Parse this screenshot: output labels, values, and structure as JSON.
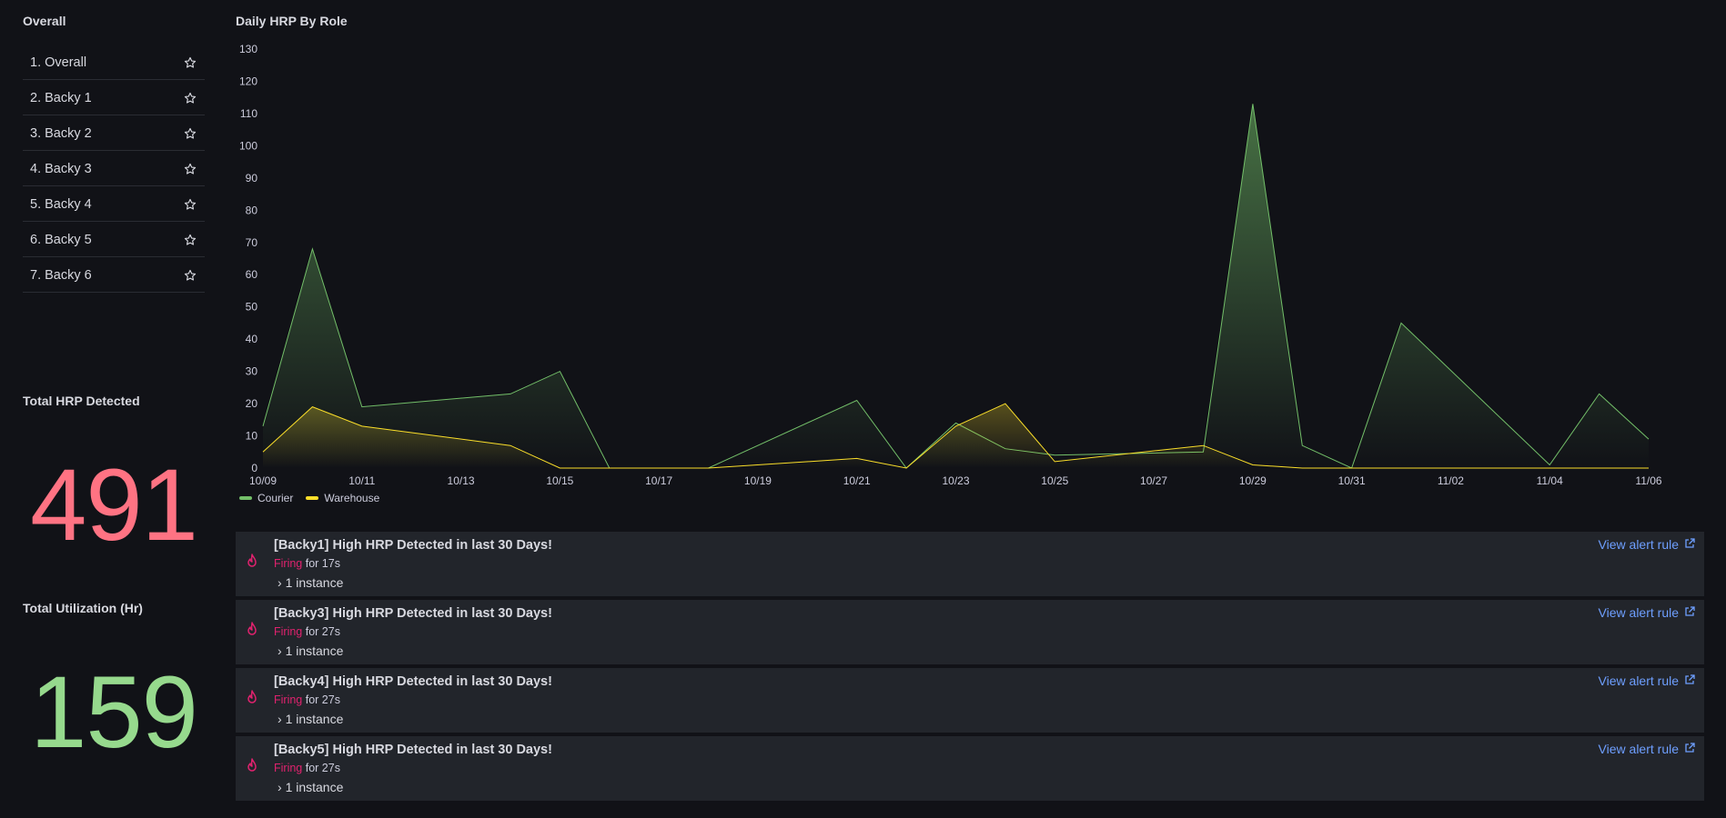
{
  "dashboard_list": {
    "title": "Overall",
    "items": [
      {
        "label": "1. Overall"
      },
      {
        "label": "2. Backy 1"
      },
      {
        "label": "3. Backy 2"
      },
      {
        "label": "4. Backy 3"
      },
      {
        "label": "5. Backy 4"
      },
      {
        "label": "6. Backy 5"
      },
      {
        "label": "7. Backy 6"
      }
    ],
    "item_icon": "star-icon"
  },
  "stats": {
    "total_hrp": {
      "title": "Total HRP Detected",
      "value": "491",
      "color": "#ff7383"
    },
    "total_util": {
      "title": "Total Utilization (Hr)",
      "value": "159",
      "color": "#96d98d"
    }
  },
  "chart_panel": {
    "title": "Daily HRP By Role"
  },
  "chart_data": {
    "type": "area",
    "title": "Daily HRP By Role",
    "x": [
      "10/09",
      "10/10",
      "10/11",
      "10/12",
      "10/13",
      "10/14",
      "10/15",
      "10/16",
      "10/17",
      "10/18",
      "10/19",
      "10/20",
      "10/21",
      "10/22",
      "10/23",
      "10/24",
      "10/25",
      "10/26",
      "10/27",
      "10/28",
      "10/29",
      "10/30",
      "10/31",
      "11/01",
      "11/02",
      "11/03",
      "11/04",
      "11/05",
      "11/06"
    ],
    "x_tick_labels": [
      "10/09",
      "10/11",
      "10/13",
      "10/15",
      "10/17",
      "10/19",
      "10/21",
      "10/23",
      "10/25",
      "10/27",
      "10/29",
      "10/31",
      "11/02",
      "11/04",
      "11/06"
    ],
    "ylim": [
      0,
      130
    ],
    "y_ticks": [
      0,
      10,
      20,
      30,
      40,
      50,
      60,
      70,
      80,
      90,
      100,
      110,
      120,
      130
    ],
    "series": [
      {
        "name": "Courier",
        "color": "#73bf69",
        "values": [
          13,
          68,
          19,
          null,
          null,
          23,
          30,
          0,
          0,
          0,
          null,
          null,
          21,
          0,
          14,
          6,
          4,
          null,
          null,
          5,
          113,
          7,
          0,
          45,
          null,
          null,
          1,
          23,
          9
        ]
      },
      {
        "name": "Warehouse",
        "color": "#fade2a",
        "values": [
          5,
          19,
          13,
          null,
          null,
          7,
          0,
          0,
          0,
          0,
          null,
          null,
          3,
          0,
          13,
          20,
          2,
          null,
          null,
          7,
          1,
          0,
          0,
          0,
          null,
          null,
          0,
          0,
          0
        ]
      }
    ],
    "legend_position": "bottom-left",
    "grid": false
  },
  "alerts": [
    {
      "title": "[Backy1] High HRP Detected in last 30 Days!",
      "state": "Firing",
      "duration": "for 17s",
      "instances": "1 instance",
      "link": "View alert rule"
    },
    {
      "title": "[Backy3] High HRP Detected in last 30 Days!",
      "state": "Firing",
      "duration": "for 27s",
      "instances": "1 instance",
      "link": "View alert rule"
    },
    {
      "title": "[Backy4] High HRP Detected in last 30 Days!",
      "state": "Firing",
      "duration": "for 27s",
      "instances": "1 instance",
      "link": "View alert rule"
    },
    {
      "title": "[Backy5] High HRP Detected in last 30 Days!",
      "state": "Firing",
      "duration": "for 27s",
      "instances": "1 instance",
      "link": "View alert rule"
    }
  ]
}
